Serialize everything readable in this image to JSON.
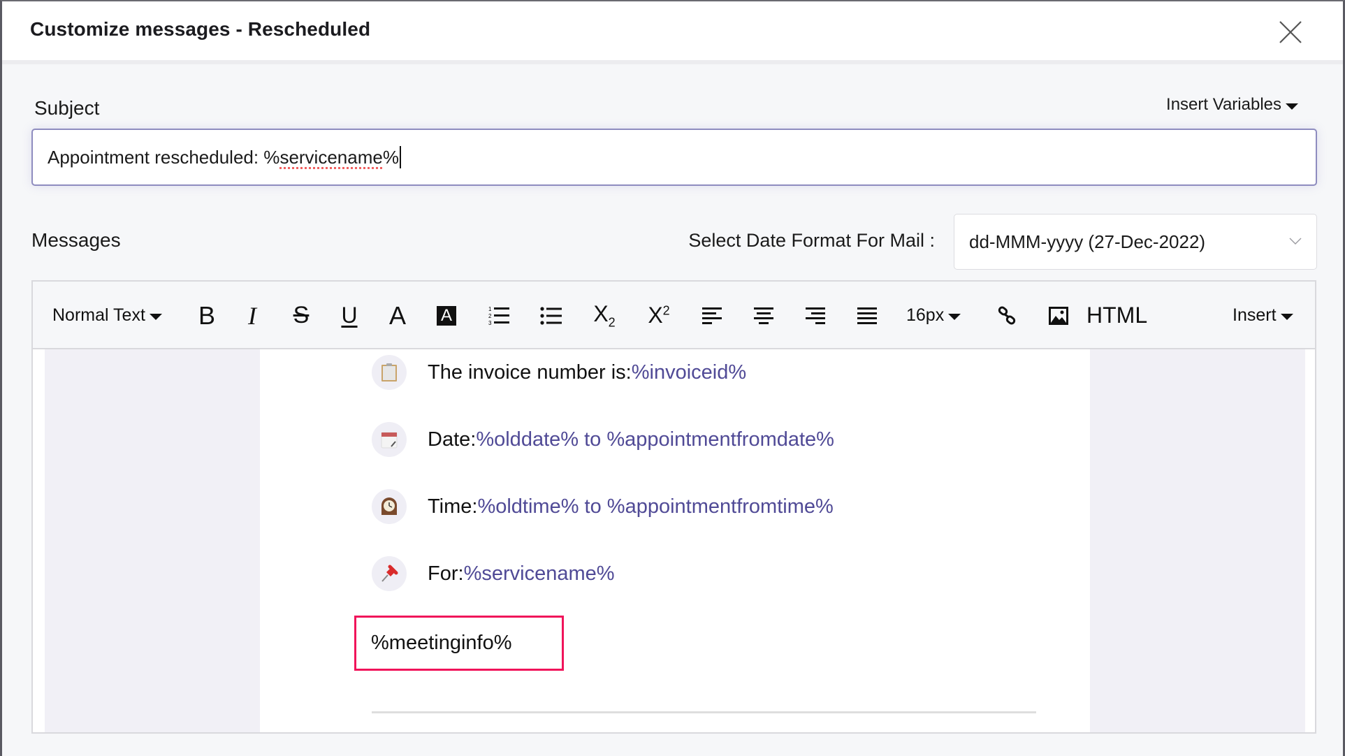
{
  "dialog": {
    "title": "Customize messages - Rescheduled",
    "close_icon": "close-icon"
  },
  "subject": {
    "label": "Subject",
    "insert_variables_label": "Insert Variables",
    "value_prefix": "Appointment rescheduled: %",
    "value_variable": "servicename",
    "value_suffix": "%"
  },
  "messages": {
    "label": "Messages",
    "date_format_label": "Select Date Format For Mail :",
    "date_format_selected": "dd-MMM-yyyy (27-Dec-2022)"
  },
  "toolbar": {
    "paragraph_style": "Normal Text",
    "bold": "B",
    "italic": "I",
    "strikethrough": "S",
    "underline": "U",
    "font_color": "A",
    "highlight_color": "A",
    "font_size": "16px",
    "html_label": "HTML",
    "insert_label": "Insert",
    "icons": [
      "bold-icon",
      "italic-icon",
      "strikethrough-icon",
      "underline-icon",
      "font-color-icon",
      "background-color-icon",
      "numbered-list-icon",
      "bulleted-list-icon",
      "subscript-icon",
      "superscript-icon",
      "align-left-icon",
      "align-center-icon",
      "align-right-icon",
      "justify-icon",
      "link-icon",
      "image-icon"
    ]
  },
  "body": {
    "rows": [
      {
        "icon": "clipboard-icon",
        "label": "The invoice number is:",
        "variable": "%invoiceid%"
      },
      {
        "icon": "calendar-icon",
        "label": "Date:",
        "variable": "%olddate% to %appointmentfromdate%"
      },
      {
        "icon": "clock-icon",
        "label": "Time:",
        "variable": "%oldtime% to %appointmentfromtime%"
      },
      {
        "icon": "pushpin-icon",
        "label": "For:",
        "variable": "%servicename%"
      }
    ],
    "meeting_info": "%meetinginfo%"
  },
  "colors": {
    "variable_text": "#504a96",
    "input_focus_border": "#8e8cbf",
    "highlight_box": "#f0145a",
    "side_panel": "#f1f0f6"
  }
}
